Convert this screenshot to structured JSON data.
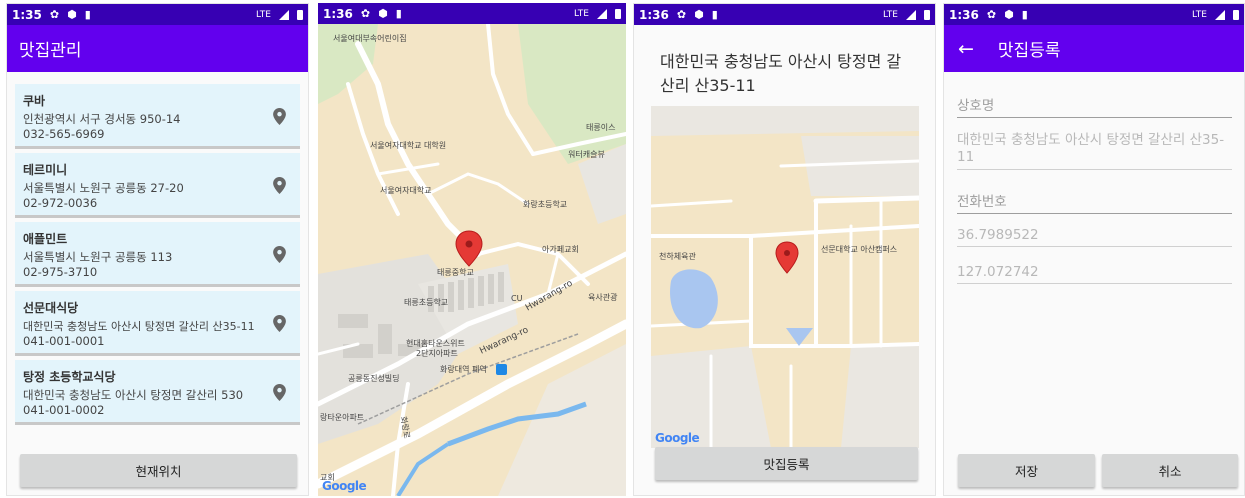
{
  "screen1": {
    "status_time": "1:35",
    "network": "LTE",
    "title": "맛집관리",
    "items": [
      {
        "name": "쿠바",
        "address": "인천광역시 서구 경서동 950-14",
        "phone": "032-565-6969"
      },
      {
        "name": "테르미니",
        "address": "서울특별시 노원구 공릉동 27-20",
        "phone": "02-972-0036"
      },
      {
        "name": "애플민트",
        "address": "서울특별시 노원구 공릉동 113",
        "phone": "02-975-3710"
      },
      {
        "name": "선문대식당",
        "address": "대한민국 충청남도 아산시 탕정면 갈산리 산35-11",
        "phone": "041-001-0001"
      },
      {
        "name": "탕정 초등학교식당",
        "address": "대한민국 충청남도 아산시 탕정면 갈산리 530",
        "phone": "041-001-0002"
      }
    ],
    "button_label": "현재위치"
  },
  "screen2": {
    "status_time": "1:36",
    "network": "LTE",
    "map_labels": {
      "l1": "서울여대부속어린이집",
      "l2": "서울여자대학교 대학원",
      "l3": "서울여자대학교",
      "l4": "화랑초등학교",
      "l5": "태릉중학교",
      "l6": "아가페교회",
      "l7": "태릉초등학교",
      "l8": "CU",
      "l9": "현대홈타운스위트",
      "l10": "2단지아파트",
      "l11": "공릉동진성빌딩",
      "l12": "화랑대역 폐역",
      "l13": "랑타운아파트",
      "l14": "Hwarang-ro",
      "l15": "Hwarang-ro",
      "l16": "태릉이스",
      "l17": "워터캐슬뷰",
      "l18": "육사관광",
      "l19": "교회",
      "l20": "화랑로"
    },
    "google": "Google"
  },
  "screen3": {
    "status_time": "1:36",
    "network": "LTE",
    "address": "대한민국 충청남도 아산시 탕정면 갈산리 산35-11",
    "map_labels": {
      "l1": "천하체육관",
      "l2": "선문대학교 아산캠퍼스"
    },
    "google": "Google",
    "button_label": "맛집등록"
  },
  "screen4": {
    "status_time": "1:36",
    "network": "LTE",
    "title": "맛집등록",
    "fields": {
      "name_placeholder": "상호명",
      "address_value": "대한민국 충청남도 아산시 탕정면 갈산리 산35-11",
      "phone_placeholder": "전화번호",
      "latitude_value": "36.7989522",
      "longitude_value": "127.072742"
    },
    "save_label": "저장",
    "cancel_label": "취소"
  },
  "colors": {
    "status_bar": "#3700b3",
    "app_bar": "#6200ee",
    "card_bg": "#e3f4fb",
    "button_bg": "#d6d7d7",
    "map_bg": "#f3e5c6",
    "map_pin": "#e53935"
  }
}
